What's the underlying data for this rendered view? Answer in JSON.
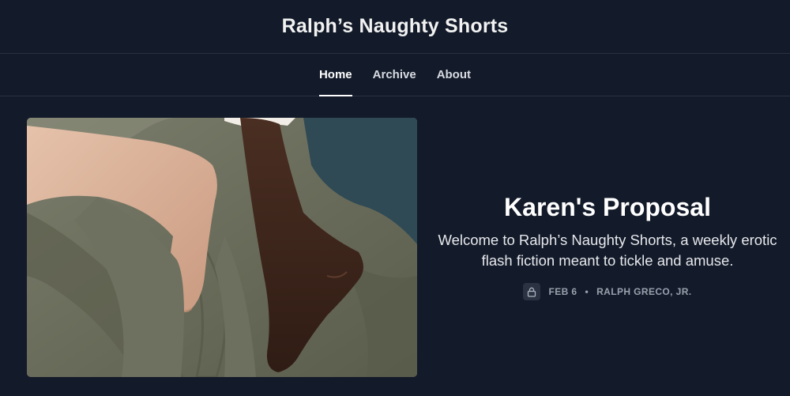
{
  "site": {
    "title": "Ralph’s Naughty Shorts"
  },
  "nav": {
    "items": [
      {
        "label": "Home",
        "active": true
      },
      {
        "label": "Archive",
        "active": false
      },
      {
        "label": "About",
        "active": false
      }
    ]
  },
  "post": {
    "title": "Karen's Proposal",
    "subtitle": "Welcome to Ralph’s Naughty Shorts, a weekly erotic flash fiction meant to tickle and amuse.",
    "date": "FEB 6",
    "separator": "•",
    "author": "RALPH GRECO, JR.",
    "icon": "lock-icon"
  },
  "colors": {
    "background": "#131a29",
    "border": "#2a3242",
    "meta": "#9aa1ae"
  }
}
